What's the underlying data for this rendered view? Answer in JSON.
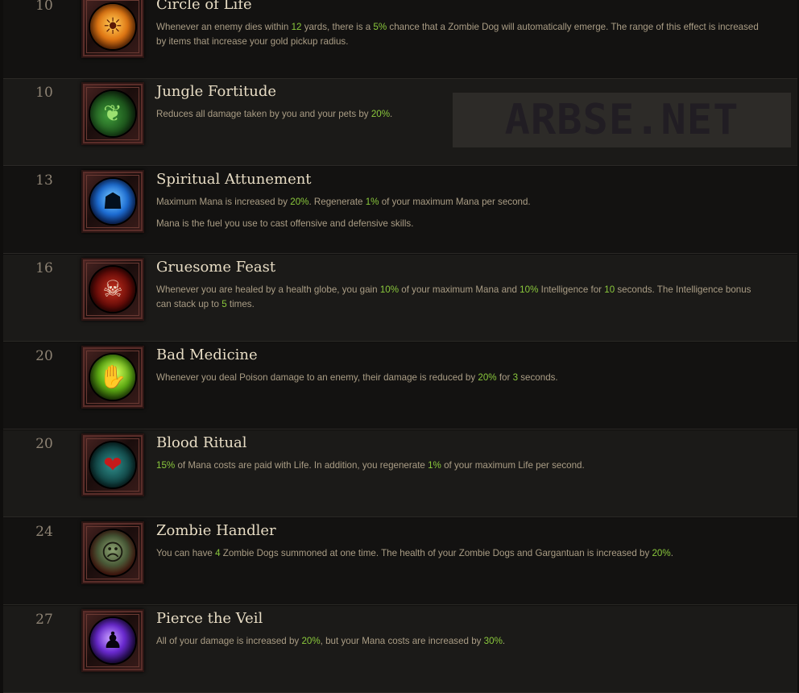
{
  "watermark": "ARBSE.NET",
  "skills": [
    {
      "level": "10",
      "name": "Circle of Life",
      "icon": "zombie-dog-sun-icon",
      "desc": [
        [
          [
            "Whenever an enemy dies within ",
            false
          ],
          [
            "12",
            true
          ],
          [
            " yards, there is a ",
            false
          ],
          [
            "5%",
            true
          ],
          [
            " chance that a Zombie Dog will automatically emerge. The range of this effect is increased by items that increase your gold pickup radius.",
            false
          ]
        ]
      ]
    },
    {
      "level": "10",
      "name": "Jungle Fortitude",
      "icon": "jungle-leaves-mask-icon",
      "desc": [
        [
          [
            "Reduces all damage taken by you and your pets by ",
            false
          ],
          [
            "20%",
            true
          ],
          [
            ".",
            false
          ]
        ]
      ]
    },
    {
      "level": "13",
      "name": "Spiritual Attunement",
      "icon": "meditating-figure-icon",
      "desc": [
        [
          [
            "Maximum Mana is increased by ",
            false
          ],
          [
            "20%",
            true
          ],
          [
            ". Regenerate ",
            false
          ],
          [
            "1%",
            true
          ],
          [
            " of your maximum Mana per second.",
            false
          ]
        ],
        [
          [
            "Mana is the fuel you use to cast offensive and defensive skills.",
            false
          ]
        ]
      ]
    },
    {
      "level": "16",
      "name": "Gruesome Feast",
      "icon": "skull-icon",
      "desc": [
        [
          [
            "Whenever you are healed by a health globe, you gain ",
            false
          ],
          [
            "10%",
            true
          ],
          [
            " of your maximum Mana and ",
            false
          ],
          [
            "10%",
            true
          ],
          [
            " Intelligence for ",
            false
          ],
          [
            "10",
            true
          ],
          [
            " seconds. The Intelligence bonus can stack up to ",
            false
          ],
          [
            "5",
            true
          ],
          [
            " times.",
            false
          ]
        ]
      ]
    },
    {
      "level": "20",
      "name": "Bad Medicine",
      "icon": "poison-hand-icon",
      "desc": [
        [
          [
            "Whenever you deal Poison damage to an enemy, their damage is reduced by ",
            false
          ],
          [
            "20%",
            true
          ],
          [
            " for ",
            false
          ],
          [
            "3",
            true
          ],
          [
            " seconds.",
            false
          ]
        ]
      ]
    },
    {
      "level": "20",
      "name": "Blood Ritual",
      "icon": "blood-heart-icon",
      "desc": [
        [
          [
            "15%",
            true
          ],
          [
            " of Mana costs are paid with Life. In addition, you regenerate ",
            false
          ],
          [
            "1%",
            true
          ],
          [
            " of your maximum Life per second.",
            false
          ]
        ]
      ]
    },
    {
      "level": "24",
      "name": "Zombie Handler",
      "icon": "zombie-face-icon",
      "desc": [
        [
          [
            "You can have ",
            false
          ],
          [
            "4",
            true
          ],
          [
            " Zombie Dogs summoned at one time. The health of your Zombie Dogs and Gargantuan is increased by ",
            false
          ],
          [
            "20%",
            true
          ],
          [
            ".",
            false
          ]
        ]
      ]
    },
    {
      "level": "27",
      "name": "Pierce the Veil",
      "icon": "hooded-figure-icon",
      "desc": [
        [
          [
            "All of your damage is increased by ",
            false
          ],
          [
            "20%",
            true
          ],
          [
            ", but your Mana costs are increased by ",
            false
          ],
          [
            "30%",
            true
          ],
          [
            ".",
            false
          ]
        ]
      ]
    }
  ]
}
